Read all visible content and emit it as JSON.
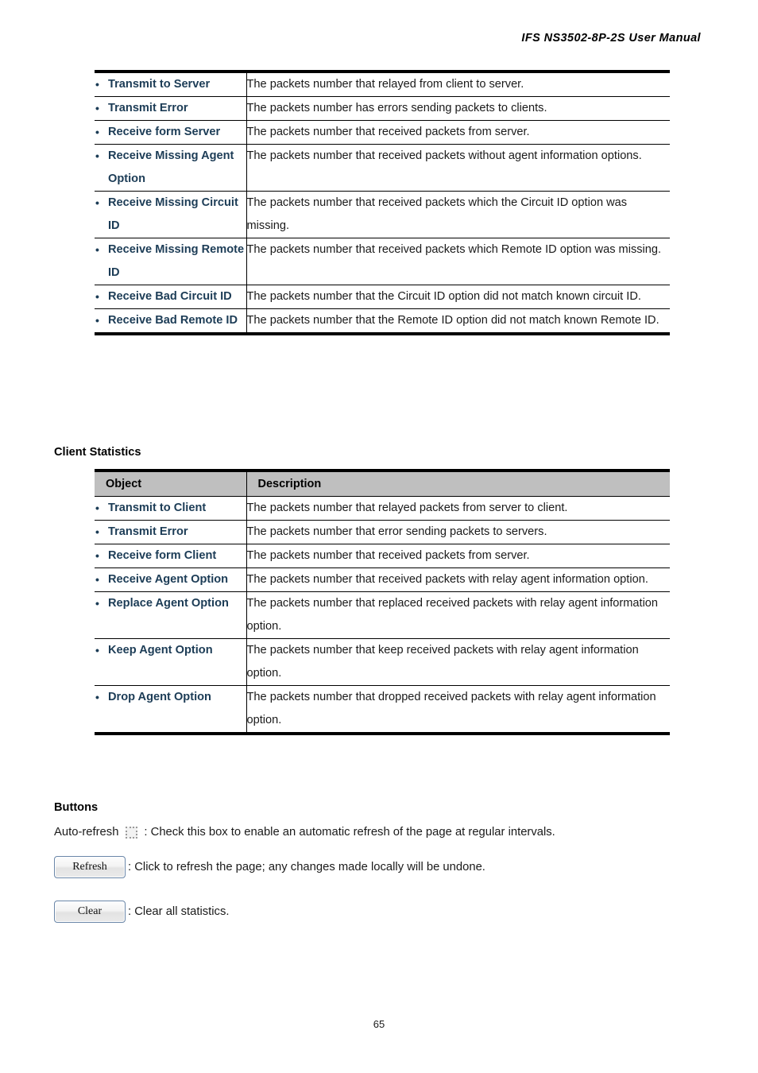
{
  "header": {
    "title": "IFS  NS3502-8P-2S  User  Manual"
  },
  "server_statistics_table": {
    "rows": [
      {
        "object": "Transmit to Server",
        "description": "The packets number that relayed from client to server."
      },
      {
        "object": "Transmit Error",
        "description": "The packets number has errors sending packets to clients."
      },
      {
        "object": "Receive form Server",
        "description": "The packets number that received packets from server."
      },
      {
        "object": "Receive Missing Agent Option",
        "description": "The packets number that received packets without agent information options."
      },
      {
        "object": "Receive Missing Circuit ID",
        "description": "The packets number that received packets which the Circuit ID option was missing."
      },
      {
        "object": "Receive Missing Remote ID",
        "description": "The packets number that received packets which Remote ID option was missing."
      },
      {
        "object": "Receive Bad Circuit ID",
        "description": "The packets number that the Circuit ID option did not match known circuit ID."
      },
      {
        "object": "Receive Bad Remote ID",
        "description": "The packets number that the Remote ID option did not match known Remote ID."
      }
    ]
  },
  "client_statistics": {
    "heading": "Client Statistics",
    "columns": {
      "object": "Object",
      "description": "Description"
    },
    "rows": [
      {
        "object": "Transmit to Client",
        "description": "The packets number that relayed packets from server to client."
      },
      {
        "object": "Transmit Error",
        "description": "The packets number that error sending packets to servers."
      },
      {
        "object": "Receive form Client",
        "description": "The packets number that received packets from server."
      },
      {
        "object": "Receive Agent Option",
        "description": "The packets number that received packets with relay agent information option."
      },
      {
        "object": "Replace Agent Option",
        "description": "The packets number that replaced received packets with relay agent information option."
      },
      {
        "object": "Keep Agent Option",
        "description": "The packets number that keep received packets with relay agent information option."
      },
      {
        "object": "Drop Agent Option",
        "description": "The packets number that dropped received packets with relay agent information option."
      }
    ]
  },
  "buttons_section": {
    "heading": "Buttons",
    "auto_refresh_label": "Auto-refresh",
    "auto_refresh_description": ": Check this box to enable an automatic refresh of the page at regular intervals.",
    "refresh_button_label": "Refresh",
    "refresh_description": ": Click to refresh the page; any changes made locally will be undone.",
    "clear_button_label": "Clear",
    "clear_description": ": Clear all statistics."
  },
  "footer": {
    "page_number": "65"
  },
  "colors": {
    "object_text": "#1c3c56",
    "table_header_background": "#bfbfbf",
    "body_text": "#1a1a1a",
    "rule": "#000000"
  }
}
